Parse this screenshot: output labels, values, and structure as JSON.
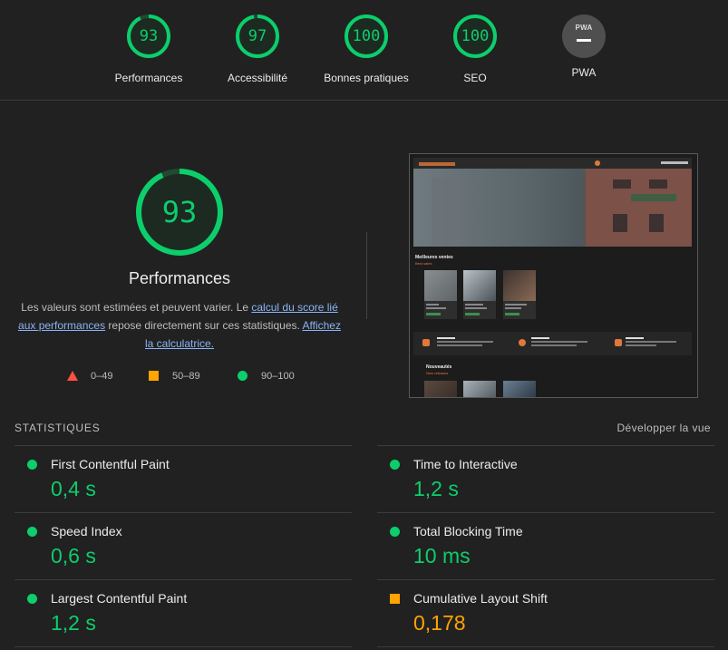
{
  "colors": {
    "pass": "#0cce6b",
    "average": "#ffa400",
    "fail": "#ff4e42",
    "link": "#8ab4f8",
    "background": "#212121"
  },
  "categories": [
    {
      "score": "93",
      "label": "Performances",
      "fraction": 0.93
    },
    {
      "score": "97",
      "label": "Accessibilité",
      "fraction": 0.97
    },
    {
      "score": "100",
      "label": "Bonnes pratiques",
      "fraction": 1.0
    },
    {
      "score": "100",
      "label": "SEO",
      "fraction": 1.0
    },
    {
      "badge": "PWA",
      "label": "PWA"
    }
  ],
  "performance": {
    "score": "93",
    "fraction": 0.93,
    "title": "Performances",
    "desc_prefix": "Les valeurs sont estimées et peuvent varier. Le ",
    "desc_link1": "calcul du score lié aux performances",
    "desc_middle": " repose directement sur ces statistiques. ",
    "desc_link2": "Affichez la calculatrice.",
    "legend": [
      {
        "icon": "fail-triangle-icon",
        "range": "0–49"
      },
      {
        "icon": "average-square-icon",
        "range": "50–89"
      },
      {
        "icon": "pass-circle-icon",
        "range": "90–100"
      }
    ]
  },
  "screenshot": {
    "section_title": "Meilleures ventes",
    "section_subtitle": "Best sales",
    "section2_title": "Nouveautés",
    "section2_subtitle": "New releases"
  },
  "stats": {
    "header": "STATISTIQUES",
    "expand_label": "Développer la vue",
    "metrics": [
      {
        "name": "First Contentful Paint",
        "value": "0,4 s",
        "rating": "pass"
      },
      {
        "name": "Time to Interactive",
        "value": "1,2 s",
        "rating": "pass"
      },
      {
        "name": "Speed Index",
        "value": "0,6 s",
        "rating": "pass"
      },
      {
        "name": "Total Blocking Time",
        "value": "10 ms",
        "rating": "pass"
      },
      {
        "name": "Largest Contentful Paint",
        "value": "1,2 s",
        "rating": "pass"
      },
      {
        "name": "Cumulative Layout Shift",
        "value": "0,178",
        "rating": "average"
      }
    ]
  }
}
